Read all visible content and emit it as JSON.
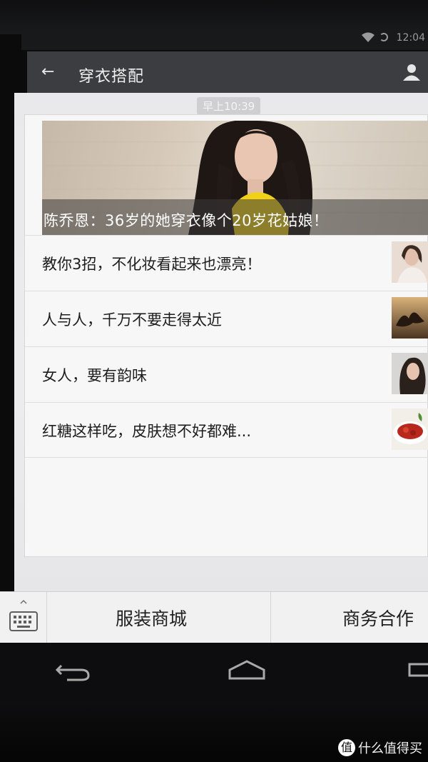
{
  "status_bar": {
    "time": "12:04"
  },
  "action_bar": {
    "back_glyph": "←",
    "title": "穿衣搭配"
  },
  "chat": {
    "timestamp": "早上10:39",
    "hero": {
      "caption": "陈乔恩：36岁的她穿衣像个20岁花姑娘！"
    },
    "items": [
      {
        "title": "教你3招，不化妆看起来也漂亮！"
      },
      {
        "title": "人与人，千万不要走得太近"
      },
      {
        "title": "女人，要有韵味"
      },
      {
        "title": "红糖这样吃，皮肤想不好都难..."
      }
    ]
  },
  "menu": {
    "items": [
      {
        "label": "服装商城"
      },
      {
        "label": "商务合作"
      }
    ]
  },
  "watermark": {
    "logo": "值",
    "text": "什么值得买"
  },
  "icons": [
    "wifi-icon",
    "battery-icon",
    "back-arrow-icon",
    "profile-icon",
    "keyboard-icon",
    "nav-back-icon",
    "nav-home-icon",
    "nav-recents-icon"
  ]
}
